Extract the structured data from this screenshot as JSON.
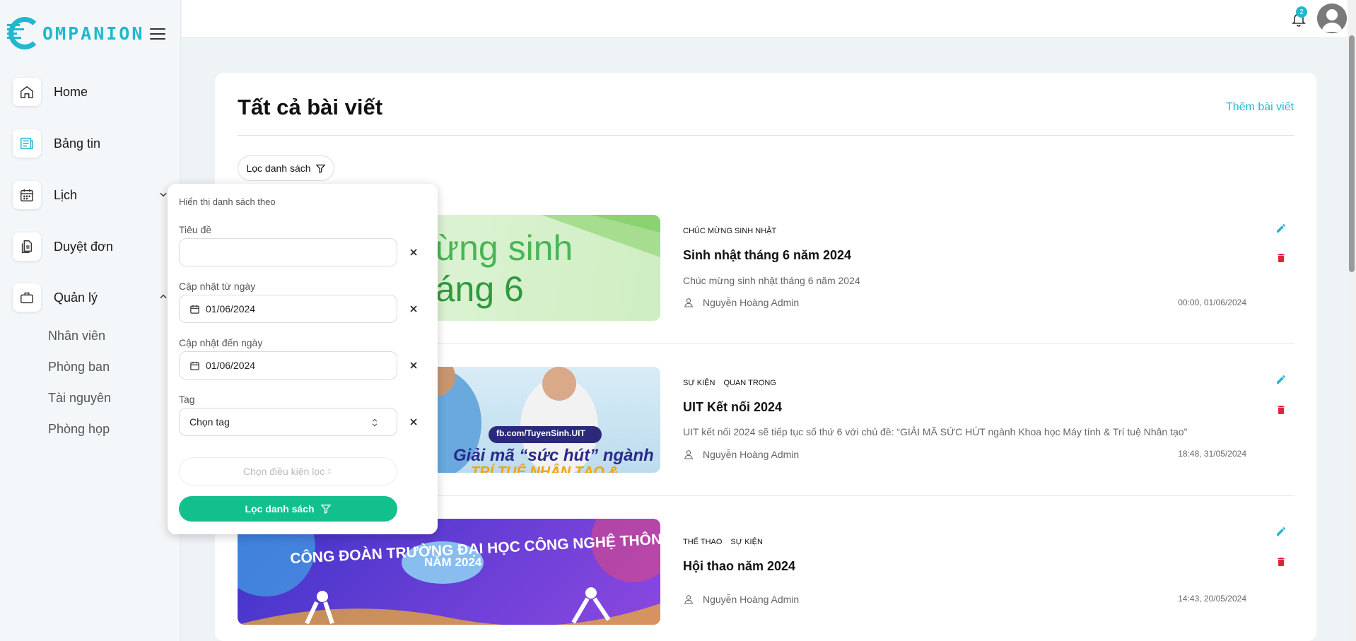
{
  "app": {
    "logo_text": "OMPANION",
    "brand_color": "#1fb8cf"
  },
  "sidebar": {
    "items": [
      {
        "label": "Home",
        "icon": "home-icon"
      },
      {
        "label": "Bảng tin",
        "icon": "newspaper-icon"
      },
      {
        "label": "Lịch",
        "icon": "calendar-icon",
        "expanded": false
      },
      {
        "label": "Duyệt đơn",
        "icon": "documents-icon"
      },
      {
        "label": "Quản lý",
        "icon": "briefcase-icon",
        "expanded": true
      }
    ],
    "subitems": [
      "Nhân viên",
      "Phòng ban",
      "Tài nguyên",
      "Phòng họp"
    ]
  },
  "topbar": {
    "notification_count": "2"
  },
  "main": {
    "title": "Tất cả bài viết",
    "add_link": "Thêm bài viết",
    "filter_button": "Lọc danh sách"
  },
  "posts": [
    {
      "tags": [
        "CHÚC MỪNG SINH NHẬT"
      ],
      "title": "Sinh nhật tháng 6 năm 2024",
      "description": "Chúc mừng sinh nhật tháng 6 năm 2024",
      "author": "Nguyễn Hoàng Admin",
      "time": "00:00, 01/06/2024",
      "image_text": [
        "mừng sinh",
        "tháng 6"
      ]
    },
    {
      "tags": [
        "SỰ KIỆN",
        "QUAN TRỌNG"
      ],
      "title": "UIT Kết nối 2024",
      "description": "UIT kết nối 2024 sẽ tiếp tục số thứ 6 với chủ đề: “GIẢI MÃ SỨC HÚT ngành Khoa học Máy tính & Trí tuệ Nhân tạo”",
      "author": "Nguyễn Hoàng Admin",
      "time": "18:48, 31/05/2024",
      "image_text": [
        "fb.com/TuyenSinh.UIT",
        "Giải mã “sức hút” ngành",
        "TRÍ TUỆ NHÂN TẠO &"
      ]
    },
    {
      "tags": [
        "THỂ THAO",
        "SỰ KIỆN"
      ],
      "title": "Hội thao năm 2024",
      "description": "",
      "author": "Nguyễn Hoàng Admin",
      "time": "14:43, 20/05/2024",
      "image_text": [
        "CÔNG ĐOÀN TRƯỜNG ĐẠI HỌC CÔNG NGHỆ THÔNG TIN",
        "NĂM 2024"
      ]
    }
  ],
  "filter_popup": {
    "header": "Hiển thị danh sách theo",
    "title_label": "Tiêu đề",
    "title_value": "",
    "from_label": "Cập nhật từ ngày",
    "from_value": "01/06/2024",
    "to_label": "Cập nhật đến ngày",
    "to_value": "01/06/2024",
    "tag_label": "Tag",
    "tag_value": "Chọn tag",
    "condition_placeholder": "Chọn điều kiện lọc",
    "apply_button": "Lọc danh sách"
  }
}
